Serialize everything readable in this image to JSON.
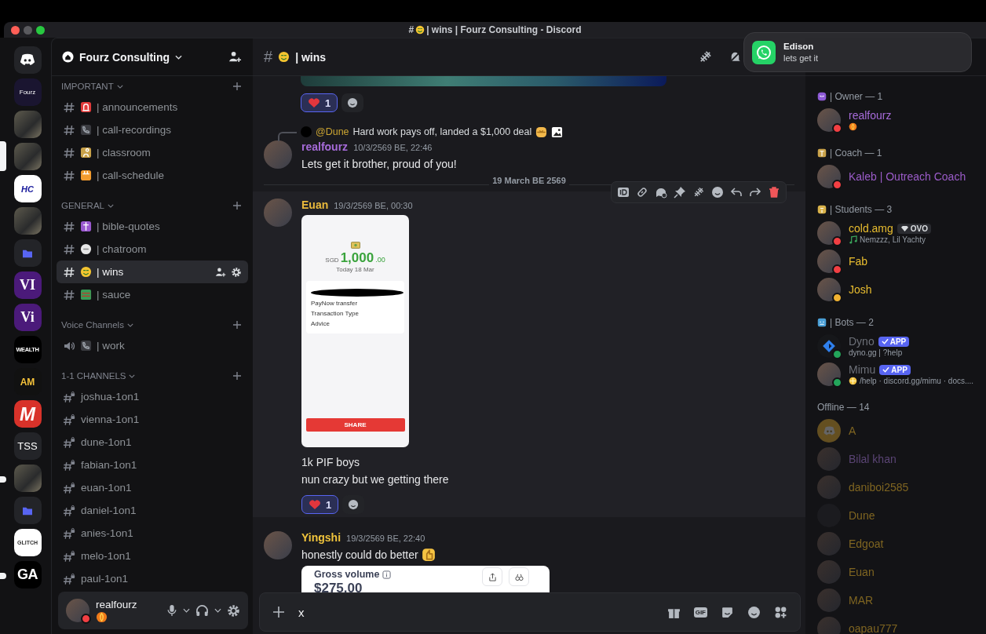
{
  "title_bar": {
    "hash": "#",
    "title": "| wins | Fourz Consulting - Discord"
  },
  "notification": {
    "title": "Edison",
    "text": "lets get it"
  },
  "servers": [
    {
      "kind": "discord",
      "selected": false,
      "unread": false
    },
    {
      "kind": "text",
      "label": "Fourz",
      "selected": false,
      "unread": false
    },
    {
      "kind": "photo",
      "selected": false,
      "unread": false
    },
    {
      "kind": "photo",
      "selected": true,
      "unread": false
    },
    {
      "kind": "text",
      "label": "HC",
      "selected": false,
      "unread": false
    },
    {
      "kind": "photo",
      "selected": false,
      "unread": false
    },
    {
      "kind": "folder",
      "selected": false,
      "unread": false
    },
    {
      "kind": "text",
      "label": "VI",
      "selected": false,
      "unread": false
    },
    {
      "kind": "text",
      "label": "Vi",
      "selected": false,
      "unread": false
    },
    {
      "kind": "text",
      "label": "WEALTH",
      "selected": false,
      "unread": false
    },
    {
      "kind": "text",
      "label": "AM",
      "selected": false,
      "unread": false
    },
    {
      "kind": "text",
      "label": "M",
      "selected": false,
      "unread": false
    },
    {
      "kind": "text",
      "label": "TSS",
      "selected": false,
      "unread": false
    },
    {
      "kind": "photo",
      "selected": false,
      "unread": true
    },
    {
      "kind": "folder",
      "selected": false,
      "unread": false
    },
    {
      "kind": "text",
      "label": "GLITCH",
      "selected": false,
      "unread": false
    },
    {
      "kind": "text",
      "label": "GA",
      "selected": false,
      "unread": true
    }
  ],
  "server": {
    "name": "Fourz Consulting"
  },
  "categories": [
    {
      "name": "IMPORTANT",
      "channels": [
        {
          "kind": "text",
          "name": "| announcements",
          "selected": false
        },
        {
          "kind": "text",
          "name": "| call-recordings",
          "selected": false
        },
        {
          "kind": "text",
          "name": "| classroom",
          "selected": false
        },
        {
          "kind": "text",
          "name": "| call-schedule",
          "selected": false
        }
      ]
    },
    {
      "name": "GENERAL",
      "channels": [
        {
          "kind": "text",
          "name": "| bible-quotes",
          "selected": false
        },
        {
          "kind": "text",
          "name": "| chatroom",
          "selected": false
        },
        {
          "kind": "text",
          "name": "| wins",
          "selected": true
        },
        {
          "kind": "text",
          "name": "| sauce",
          "selected": false
        }
      ]
    },
    {
      "name": "Voice Channels",
      "channels": [
        {
          "kind": "voice",
          "name": "| work",
          "selected": false
        }
      ]
    },
    {
      "name": "1-1 CHANNELS",
      "channels": [
        {
          "kind": "private",
          "name": "joshua-1on1",
          "selected": false
        },
        {
          "kind": "private",
          "name": "vienna-1on1",
          "selected": false
        },
        {
          "kind": "private",
          "name": "dune-1on1",
          "selected": false
        },
        {
          "kind": "private",
          "name": "fabian-1on1",
          "selected": false
        },
        {
          "kind": "private",
          "name": "euan-1on1",
          "selected": false
        },
        {
          "kind": "private",
          "name": "daniel-1on1",
          "selected": false
        },
        {
          "kind": "private",
          "name": "anies-1on1",
          "selected": false
        },
        {
          "kind": "private",
          "name": "melo-1on1",
          "selected": false
        },
        {
          "kind": "private",
          "name": "paul-1on1",
          "selected": false
        }
      ]
    }
  ],
  "user_panel": {
    "name": "realfourz",
    "status": {
      "color": "#f23f43"
    }
  },
  "channel_header": {
    "hash": "#",
    "name": "| wins"
  },
  "messages": [
    {
      "kind": "attachment-tail",
      "reactions": [
        {
          "count": "1",
          "selected": true
        }
      ]
    },
    {
      "kind": "message",
      "reply": {
        "mention": "@Dune",
        "text": "Hard work pays off, landed a $1,000 deal"
      },
      "author": "realfourz",
      "color": "#a66bd9",
      "time": "10/3/2569 BE, 22:46",
      "hovered": false,
      "content": [
        {
          "kind": "text",
          "text": "Lets get it brother, proud of you!"
        }
      ]
    },
    {
      "kind": "divider",
      "text": "19 March BE 2569"
    },
    {
      "kind": "message",
      "author": "Euan",
      "color": "#e9b93c",
      "time": "19/3/2569 BE, 00:30",
      "hovered": true,
      "content": [
        {
          "kind": "receipt",
          "currency": "SGD",
          "amount": "1,000",
          "cents": ".00",
          "date": "Today 18 Mar",
          "fields": [
            "PayNow transfer",
            "Transaction Type",
            "Advice"
          ],
          "button": "SHARE"
        },
        {
          "kind": "text",
          "text": "1k PIF boys"
        },
        {
          "kind": "text",
          "text": "nun crazy but we getting there"
        }
      ],
      "reactions": [
        {
          "count": "1",
          "selected": true
        }
      ]
    },
    {
      "kind": "message",
      "author": "Yingshi",
      "color": "#f0c43c",
      "time": "19/3/2569 BE, 22:40",
      "hovered": false,
      "content": [
        {
          "kind": "emoji-text",
          "text": "honestly could do better"
        },
        {
          "kind": "stat-card",
          "label": "Gross volume",
          "amount": "$275.00"
        }
      ]
    }
  ],
  "composer": {
    "value": "x",
    "gif_label": "GIF"
  },
  "member_groups": [
    {
      "name": "| Owner — 1",
      "members": [
        {
          "name": "realfourz",
          "color": "#a66bd9",
          "status": {
            "color": "#f23f43"
          }
        }
      ]
    },
    {
      "name": "| Coach — 1",
      "members": [
        {
          "name": "Kaleb | Outreach Coach",
          "color": "#9b5cc9",
          "status": {
            "color": "#f23f43"
          }
        }
      ]
    },
    {
      "name": "| Students — 3",
      "members": [
        {
          "name": "cold.amg",
          "color": "#e9bd2f",
          "status": {
            "color": "#f23f43"
          },
          "tag": "OVO",
          "subtitle": "Nemzzz, Lil Yachty"
        },
        {
          "name": "Fab",
          "color": "#e9bd2f",
          "status": {
            "color": "#f23f43"
          }
        },
        {
          "name": "Josh",
          "color": "#e9bd2f",
          "status": {
            "color": "#f0b232"
          }
        }
      ]
    },
    {
      "name": "| Bots — 2",
      "members": [
        {
          "name": "Dyno",
          "color": "#6d7078",
          "status": {
            "color": "#23a55a"
          },
          "badge": "APP",
          "subtitle": "dyno.gg | ?help"
        },
        {
          "name": "Mimu",
          "color": "#6d7078",
          "status": {
            "color": "#23a55a"
          },
          "badge": "APP",
          "subtitle": "/help · discord.gg/mimu · docs...."
        }
      ]
    },
    {
      "name": "Offline — 14",
      "members": [
        {
          "name": "A",
          "color": "#7f6521"
        },
        {
          "name": "Bilal khan",
          "color": "#5a4474"
        },
        {
          "name": "daniboi2585",
          "color": "#7f6521"
        },
        {
          "name": "Dune",
          "color": "#7f6521"
        },
        {
          "name": "Edgoat",
          "color": "#7f6521"
        },
        {
          "name": "Euan",
          "color": "#7f6521"
        },
        {
          "name": "MAR",
          "color": "#7f6521"
        },
        {
          "name": "oapau777",
          "color": "#7f6521"
        }
      ]
    }
  ]
}
